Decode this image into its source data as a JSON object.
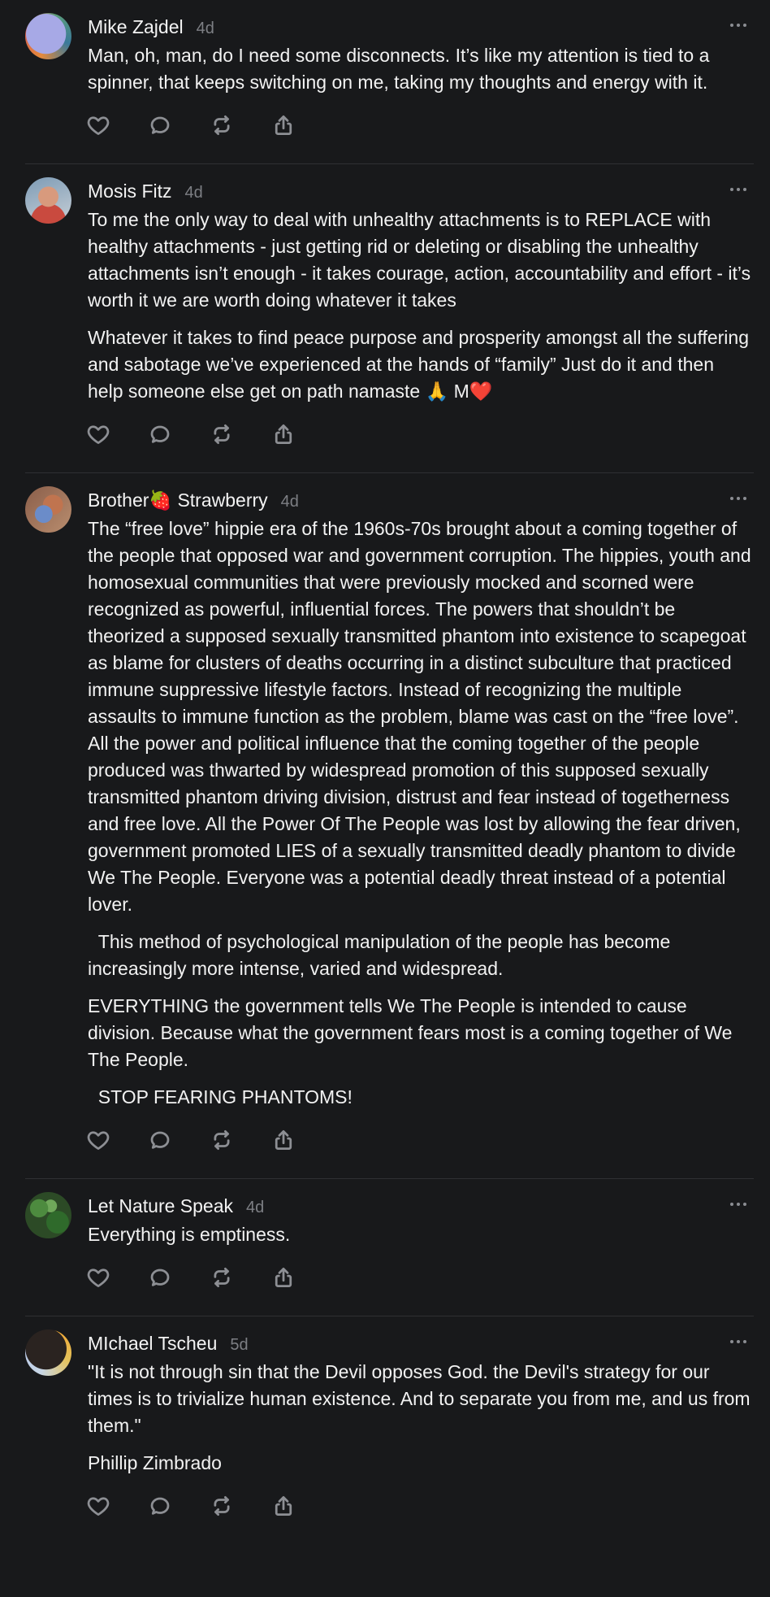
{
  "colors": {
    "background": "#18191b",
    "text": "#f2f2f2",
    "muted": "#7d7f84",
    "icon": "#8d8f94",
    "divider": "#2f3033"
  },
  "action_icons": [
    "heart-icon",
    "comment-icon",
    "repost-icon",
    "share-icon"
  ],
  "posts": [
    {
      "author": "Mike Zajdel",
      "time": "4d",
      "paragraphs": [
        "Man, oh, man, do I need some disconnects. It’s like my attention is tied to a spinner, that keeps switching on me, taking my thoughts and energy with it."
      ]
    },
    {
      "author": "Mosis Fitz",
      "time": "4d",
      "paragraphs": [
        "To me the only way to deal with unhealthy attachments is to REPLACE with healthy attachments - just getting rid or deleting or disabling the unhealthy attachments isn’t enough - it takes courage, action, accountability and effort - it’s worth it we are worth doing whatever it takes",
        "Whatever it takes to find peace purpose and prosperity amongst all the suffering and sabotage we’ve experienced at the hands of “family” Just do it and then help someone else get on path namaste 🙏 M❤️"
      ]
    },
    {
      "author": "Brother🍓 Strawberry",
      "time": "4d",
      "paragraphs": [
        "The “free love” hippie era of the 1960s-70s brought about a coming together of the people that opposed war and government corruption. The hippies, youth and homosexual communities that were previously mocked and scorned were recognized as powerful, influential forces. The powers that shouldn’t be theorized a supposed sexually transmitted phantom into existence to scapegoat as blame for clusters of deaths occurring in a distinct subculture that practiced immune suppressive lifestyle factors. Instead of recognizing the multiple assaults to immune function as the problem, blame was cast on the “free love”. All the power and political influence that the coming together of the people produced was thwarted by widespread promotion of this supposed sexually transmitted phantom driving division, distrust and fear instead of togetherness and free love. All the Power Of The People was lost by allowing the fear driven, government promoted LIES of a sexually transmitted deadly phantom to divide We The People. Everyone was a potential deadly threat instead of a potential lover.",
        "  This method of psychological manipulation of the people has become increasingly more intense, varied and widespread.",
        "EVERYTHING the government tells We The People is intended to cause division. Because what the government fears most is a coming together of We The People.",
        "  STOP FEARING PHANTOMS!"
      ]
    },
    {
      "author": "Let Nature Speak",
      "time": "4d",
      "paragraphs": [
        "Everything is emptiness."
      ]
    },
    {
      "author": "MIchael Tscheu",
      "time": "5d",
      "paragraphs": [
        "\"It is not through sin that the Devil opposes God. the Devil's strategy for our times is to trivialize human existence. And to separate you from me, and us from them.\"",
        "Phillip Zimbrado"
      ]
    }
  ]
}
